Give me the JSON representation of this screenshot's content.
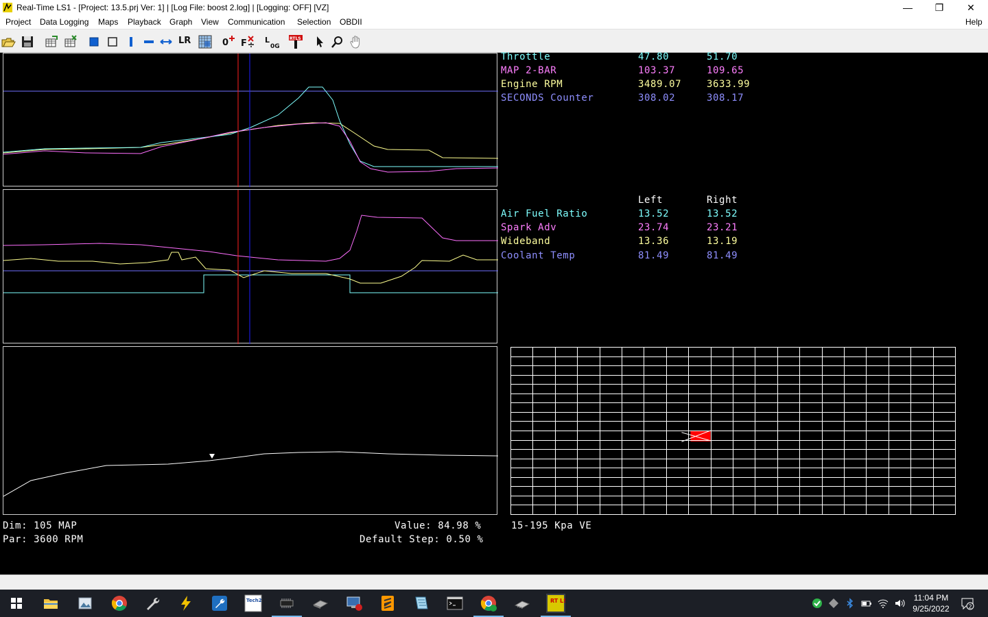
{
  "window": {
    "title": "Real-Time LS1 - [Project: 13.5.prj Ver: 1] | [Log File: boost 2.log] | [Logging: OFF] [VZ]",
    "minimize_glyph": "—",
    "maximize_glyph": "❐",
    "close_glyph": "✕"
  },
  "menu": {
    "items": [
      "Project",
      "Data Logging",
      "Maps",
      "Playback",
      "Graph",
      "View",
      "Communication",
      "Selection",
      "OBDII"
    ],
    "help": "Help"
  },
  "toolbar": {
    "icons": [
      "open-folder-icon",
      "save-icon",
      "load-table-icon",
      "save-table-icon",
      "blue-square-icon",
      "hollow-square-icon",
      "vertical-bar-icon",
      "horizontal-bar-icon",
      "horizontal-arrows-icon",
      "lr-icon",
      "grid-select-icon",
      "zero-plus-icon",
      "fx-icon",
      "log-icon",
      "pin-icon",
      "pointer-icon",
      "zoom-icon",
      "hand-icon"
    ],
    "lr_label": "LR",
    "zero_label": "0",
    "fx_label": "F",
    "log_label": "L",
    "log_sub": "0G",
    "pin_label": "RTLS"
  },
  "readout_top": {
    "rows": [
      {
        "label": "Throttle",
        "left": "47.80",
        "right": "51.70",
        "color": "#7fffff"
      },
      {
        "label": "MAP 2-BAR",
        "left": "103.37",
        "right": "109.65",
        "color": "#ff7fff"
      },
      {
        "label": "Engine RPM",
        "left": "3489.07",
        "right": "3633.99",
        "color": "#ffff9f"
      },
      {
        "label": "SECONDS Counter",
        "left": "308.02",
        "right": "308.17",
        "color": "#8f8fff"
      }
    ]
  },
  "readout_bottom": {
    "header_left": "Left",
    "header_right": "Right",
    "rows": [
      {
        "label": "Air Fuel Ratio",
        "left": "13.52",
        "right": "13.52",
        "color": "#7fffff"
      },
      {
        "label": "Spark Adv",
        "left": "23.74",
        "right": "23.21",
        "color": "#ff7fff"
      },
      {
        "label": "Wideband",
        "left": "13.36",
        "right": "13.19",
        "color": "#ffff9f"
      },
      {
        "label": "Coolant Temp",
        "left": "81.49",
        "right": "81.49",
        "color": "#8f8fff"
      }
    ]
  },
  "info": {
    "dim": "Dim: 105 MAP",
    "par": "Par: 3600 RPM",
    "value": "Value: 84.98 %",
    "default_step": "Default Step: 0.50 %",
    "table_name": "15-195 Kpa VE"
  },
  "table_grid": {
    "columns": 20,
    "rows": 18,
    "highlight_column": 8,
    "highlight_row": 9
  },
  "colors": {
    "cyan": "#7fffff",
    "magenta": "#ff6fff",
    "yellow": "#ffff8f",
    "blue_line": "#6f6fff",
    "cursor_red": "#ff2020",
    "cursor_blue": "#2020ff",
    "highlight": "#ff0000"
  },
  "taskbar": {
    "apps": [
      "start-icon",
      "file-explorer-icon",
      "photos-icon",
      "chrome-icon",
      "wrench-icon",
      "lightning-icon",
      "tuning-icon",
      "tech2win-icon",
      "ecu-chip-icon",
      "scanner-icon",
      "network-icon",
      "sublime-icon",
      "notes-icon",
      "terminal-icon",
      "chrome-profile-icon",
      "chip-icon",
      "rtls-icon"
    ],
    "tech2win_label": "Tech2 Win",
    "rtls_label": "RT LS1",
    "time": "11:04 PM",
    "date": "9/25/2022",
    "notification_count": "2"
  }
}
